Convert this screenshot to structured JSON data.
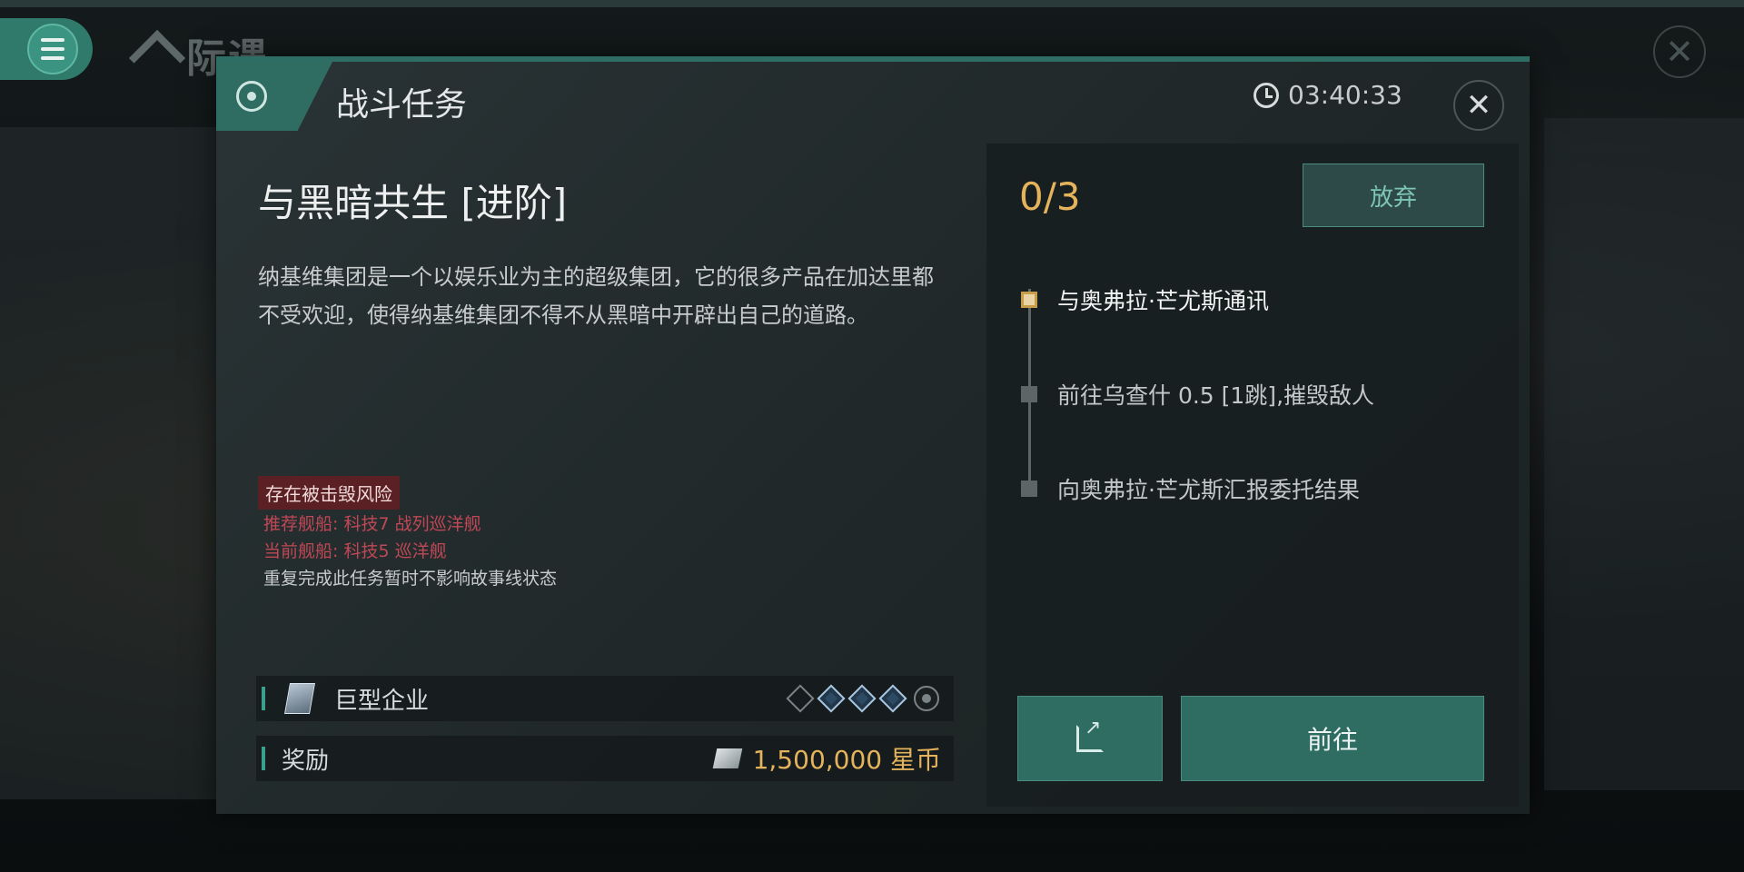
{
  "app": {
    "name": "际遇"
  },
  "dialog": {
    "title": "战斗任务",
    "timer": "03:40:33"
  },
  "mission": {
    "name": "与黑暗共生 [进阶]",
    "description": "纳基维集团是一个以娱乐业为主的超级集团，它的很多产品在加达里都不受欢迎，使得纳基维集团不得不从黑暗中开辟出自己的道路。",
    "warning_badge": "存在被击毁风险",
    "recommended_ship": "推荐舰船: 科技7 战列巡洋舰",
    "current_ship": "当前舰船: 科技5 巡洋舰",
    "note": "重复完成此任务暂时不影响故事线状态"
  },
  "faction": {
    "label": "巨型企业",
    "rank_filled": 3,
    "rank_total": 4
  },
  "reward": {
    "label": "奖励",
    "amount": "1,500,000 星币"
  },
  "objectives": {
    "progress": "0/3",
    "abandon_label": "放弃",
    "steps": [
      {
        "text": "与奥弗拉·芒尤斯通讯",
        "active": true
      },
      {
        "text": "前往乌查什 0.5 [1跳],摧毁敌人",
        "active": false
      },
      {
        "text": "向奥弗拉·芒尤斯汇报委托结果",
        "active": false
      }
    ],
    "go_label": "前往"
  },
  "colors": {
    "accent": "#2f6d63",
    "gold": "#e4b35b",
    "warning": "#c04755"
  }
}
